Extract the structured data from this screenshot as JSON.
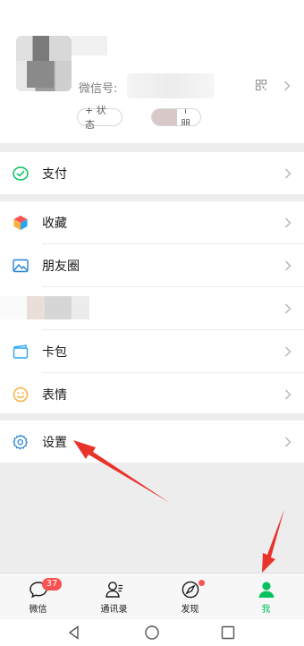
{
  "profile": {
    "wechat_id_label": "微信号:",
    "status_chip": "+ 状态",
    "friends_chip": "2个朋友"
  },
  "menu": {
    "pay": "支付",
    "favorites": "收藏",
    "moments": "朋友圈",
    "cards": "卡包",
    "stickers": "表情",
    "settings": "设置"
  },
  "tabs": {
    "chats": "微信",
    "chats_badge": "37",
    "contacts": "通讯录",
    "discover": "发现",
    "me": "我"
  },
  "colors": {
    "accent_green": "#07c160",
    "badge_red": "#fa5151",
    "annotation_red": "#e8332b"
  },
  "icons": {
    "pay": "wallet-check-icon",
    "favorites": "cube-icon",
    "moments": "landscape-photo-icon",
    "cards": "card-holder-icon",
    "stickers": "smiley-icon",
    "settings": "gear-icon"
  }
}
